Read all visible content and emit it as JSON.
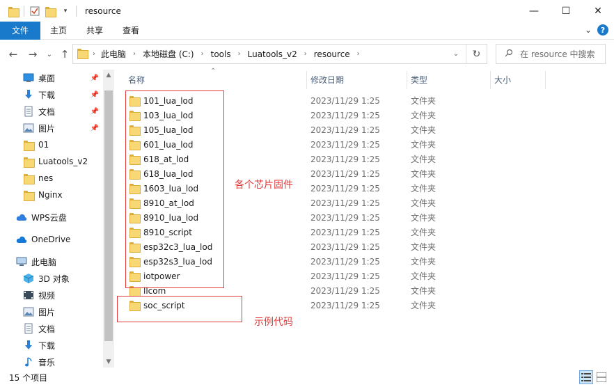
{
  "window": {
    "title": "resource",
    "minimize_glyph": "—",
    "maximize_glyph": "☐",
    "close_glyph": "✕"
  },
  "ribbon": {
    "tabs": [
      "文件",
      "主页",
      "共享",
      "查看"
    ],
    "expand_glyph": "⌄",
    "help_glyph": "?"
  },
  "address": {
    "back_glyph": "←",
    "forward_glyph": "→",
    "history_glyph": "⌄",
    "up_glyph": "↑",
    "crumbs": [
      "此电脑",
      "本地磁盘 (C:)",
      "tools",
      "Luatools_v2",
      "resource"
    ],
    "refresh_glyph": "↻"
  },
  "search": {
    "placeholder": "在 resource 中搜索"
  },
  "nav": {
    "quick_access": [
      {
        "label": "桌面",
        "icon": "desktop-icon",
        "pinned": true
      },
      {
        "label": "下载",
        "icon": "download-icon",
        "pinned": true
      },
      {
        "label": "文档",
        "icon": "documents-icon",
        "pinned": true
      },
      {
        "label": "图片",
        "icon": "pictures-icon",
        "pinned": true
      },
      {
        "label": "01",
        "icon": "folder-icon",
        "pinned": false
      },
      {
        "label": "Luatools_v2",
        "icon": "folder-icon",
        "pinned": false
      },
      {
        "label": "nes",
        "icon": "folder-icon",
        "pinned": false
      },
      {
        "label": "Nginx",
        "icon": "folder-icon",
        "pinned": false
      }
    ],
    "wps": "WPS云盘",
    "onedrive": "OneDrive",
    "this_pc": "此电脑",
    "pc_items": [
      {
        "label": "3D 对象",
        "icon": "3d-objects-icon"
      },
      {
        "label": "视频",
        "icon": "videos-icon"
      },
      {
        "label": "图片",
        "icon": "pictures-icon"
      },
      {
        "label": "文档",
        "icon": "documents-icon"
      },
      {
        "label": "下载",
        "icon": "download-icon"
      },
      {
        "label": "音乐",
        "icon": "music-icon"
      }
    ]
  },
  "columns": {
    "name": "名称",
    "date": "修改日期",
    "type": "类型",
    "size": "大小"
  },
  "files": [
    {
      "name": "101_lua_lod",
      "date": "2023/11/29 1:25",
      "type": "文件夹"
    },
    {
      "name": "103_lua_lod",
      "date": "2023/11/29 1:25",
      "type": "文件夹"
    },
    {
      "name": "105_lua_lod",
      "date": "2023/11/29 1:25",
      "type": "文件夹"
    },
    {
      "name": "601_lua_lod",
      "date": "2023/11/29 1:25",
      "type": "文件夹"
    },
    {
      "name": "618_at_lod",
      "date": "2023/11/29 1:25",
      "type": "文件夹"
    },
    {
      "name": "618_lua_lod",
      "date": "2023/11/29 1:25",
      "type": "文件夹"
    },
    {
      "name": "1603_lua_lod",
      "date": "2023/11/29 1:25",
      "type": "文件夹"
    },
    {
      "name": "8910_at_lod",
      "date": "2023/11/29 1:25",
      "type": "文件夹"
    },
    {
      "name": "8910_lua_lod",
      "date": "2023/11/29 1:25",
      "type": "文件夹"
    },
    {
      "name": "8910_script",
      "date": "2023/11/29 1:25",
      "type": "文件夹"
    },
    {
      "name": "esp32c3_lua_lod",
      "date": "2023/11/29 1:25",
      "type": "文件夹"
    },
    {
      "name": "esp32s3_lua_lod",
      "date": "2023/11/29 1:25",
      "type": "文件夹"
    },
    {
      "name": "iotpower",
      "date": "2023/11/29 1:25",
      "type": "文件夹"
    },
    {
      "name": "llcom",
      "date": "2023/11/29 1:25",
      "type": "文件夹"
    },
    {
      "name": "soc_script",
      "date": "2023/11/29 1:25",
      "type": "文件夹"
    }
  ],
  "annotations": {
    "firmware": "各个芯片固件",
    "example": "示例代码",
    "color": "#e23a3a"
  },
  "status": {
    "count": "15 个项目"
  },
  "colors": {
    "accent": "#1979ca",
    "folder": "#f8d775"
  }
}
